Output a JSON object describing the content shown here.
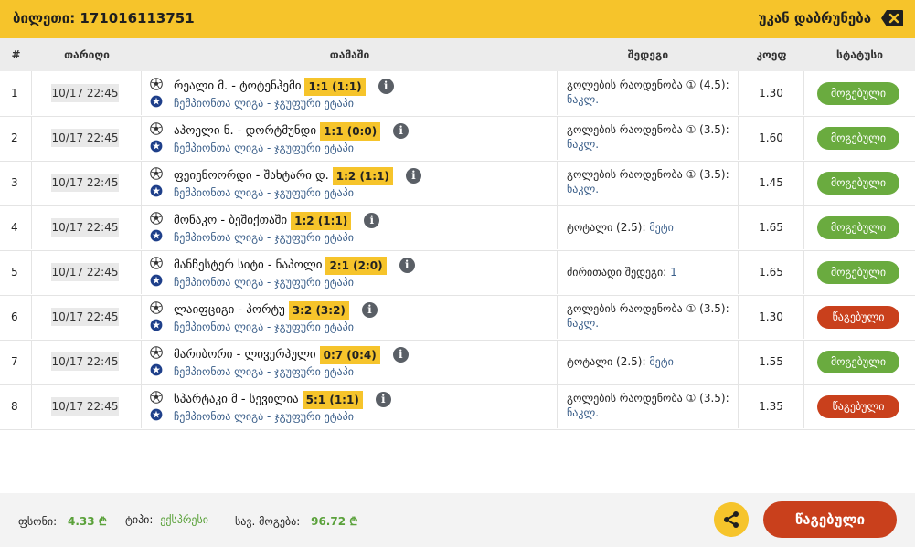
{
  "header": {
    "ticket_label": "ბილეთი: 171016113751",
    "back_label": "უკან დაბრუნება"
  },
  "columns": {
    "num": "#",
    "date": "თარიღი",
    "game": "თამაში",
    "result": "შედეგი",
    "odds": "კოეფ",
    "status": "სტატუსი"
  },
  "rows": [
    {
      "num": "1",
      "date": "10/17 22:45",
      "match": "რეალი მ. - ტოტენჰემი",
      "score": "1:1 (1:1)",
      "league": "ჩემპიონთა ლიგა - ჯგუფური ეტაპი",
      "result_label": "გოლების რაოდენობა ① (4.5):",
      "result_value": "ნაკლ.",
      "odds": "1.30",
      "status": "მოგებული"
    },
    {
      "num": "2",
      "date": "10/17 22:45",
      "match": "აპოელი ნ. - დორტმუნდი",
      "score": "1:1 (0:0)",
      "league": "ჩემპიონთა ლიგა - ჯგუფური ეტაპი",
      "result_label": "გოლების რაოდენობა ① (3.5):",
      "result_value": "ნაკლ.",
      "odds": "1.60",
      "status": "მოგებული"
    },
    {
      "num": "3",
      "date": "10/17 22:45",
      "match": "ფეიენოორდი - შახტარი დ.",
      "score": "1:2 (1:1)",
      "league": "ჩემპიონთა ლიგა - ჯგუფური ეტაპი",
      "result_label": "გოლების რაოდენობა ① (3.5):",
      "result_value": "ნაკლ.",
      "odds": "1.45",
      "status": "მოგებული"
    },
    {
      "num": "4",
      "date": "10/17 22:45",
      "match": "მონაკო - ბეშიქთაში",
      "score": "1:2 (1:1)",
      "league": "ჩემპიონთა ლიგა - ჯგუფური ეტაპი",
      "result_label": "ტოტალი (2.5):",
      "result_value": "მეტი",
      "odds": "1.65",
      "status": "მოგებული"
    },
    {
      "num": "5",
      "date": "10/17 22:45",
      "match": "მანჩესტერ სიტი - ნაპოლი",
      "score": "2:1 (2:0)",
      "league": "ჩემპიონთა ლიგა - ჯგუფური ეტაპი",
      "result_label": "ძირითადი შედეგი:",
      "result_value": "1",
      "odds": "1.65",
      "status": "მოგებული"
    },
    {
      "num": "6",
      "date": "10/17 22:45",
      "match": "ლაიფციგი - პორტუ",
      "score": "3:2 (3:2)",
      "league": "ჩემპიონთა ლიგა - ჯგუფური ეტაპი",
      "result_label": "გოლების რაოდენობა ① (3.5):",
      "result_value": "ნაკლ.",
      "odds": "1.30",
      "status": "წაგებული"
    },
    {
      "num": "7",
      "date": "10/17 22:45",
      "match": "მარიბორი - ლივერპული",
      "score": "0:7 (0:4)",
      "league": "ჩემპიონთა ლიგა - ჯგუფური ეტაპი",
      "result_label": "ტოტალი (2.5):",
      "result_value": "მეტი",
      "odds": "1.55",
      "status": "მოგებული"
    },
    {
      "num": "8",
      "date": "10/17 22:45",
      "match": "სპარტაკი მ - სევილია",
      "score": "5:1 (1:1)",
      "league": "ჩემპიონთა ლიგა - ჯგუფური ეტაპი",
      "result_label": "გოლების რაოდენობა ① (3.5):",
      "result_value": "ნაკლ.",
      "odds": "1.35",
      "status": "წაგებული"
    }
  ],
  "footer": {
    "stake_label": "ფსონი:",
    "stake_value": "4.33 ₾",
    "type_label": "ტიპი:",
    "type_value": "ექსპრესი",
    "win_label": "სავ. მოგება:",
    "win_value": "96.72 ₾",
    "final_status": "წაგებული"
  },
  "icons": {
    "close": "backspace-x-icon",
    "share": "share-icon",
    "info": "info-icon",
    "ball": "soccer-ball-icon",
    "league": "champions-league-icon"
  },
  "colors": {
    "accent": "#f6c42b",
    "won": "#6aab3f",
    "lost": "#c9401c"
  }
}
